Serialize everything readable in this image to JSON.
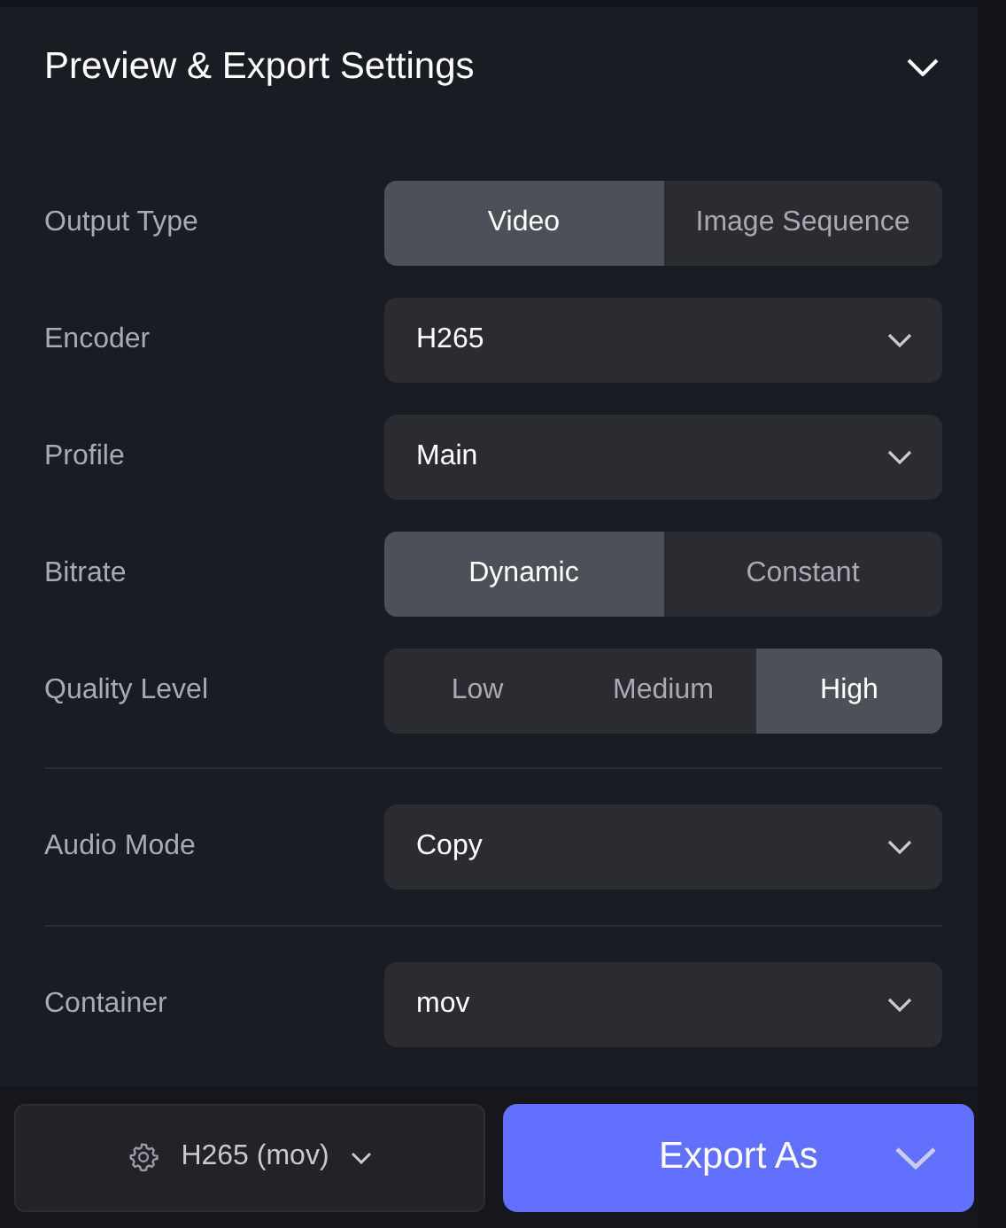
{
  "panel": {
    "title": "Preview & Export Settings",
    "expanded": true
  },
  "sections": [
    [
      {
        "kind": "segmented",
        "label": "Output Type",
        "options": [
          {
            "label": "Video",
            "selected": true
          },
          {
            "label": "Image Sequence",
            "selected": false
          }
        ]
      },
      {
        "kind": "select",
        "label": "Encoder",
        "value": "H265"
      },
      {
        "kind": "select",
        "label": "Profile",
        "value": "Main"
      },
      {
        "kind": "segmented",
        "label": "Bitrate",
        "options": [
          {
            "label": "Dynamic",
            "selected": true
          },
          {
            "label": "Constant",
            "selected": false
          }
        ]
      },
      {
        "kind": "segmented",
        "label": "Quality Level",
        "options": [
          {
            "label": "Low",
            "selected": false
          },
          {
            "label": "Medium",
            "selected": false
          },
          {
            "label": "High",
            "selected": true
          }
        ]
      }
    ],
    [
      {
        "kind": "select",
        "label": "Audio Mode",
        "value": "Copy"
      }
    ],
    [
      {
        "kind": "select",
        "label": "Container",
        "value": "mov"
      }
    ]
  ],
  "footer": {
    "preset": "H265 (mov)",
    "export": "Export As"
  }
}
